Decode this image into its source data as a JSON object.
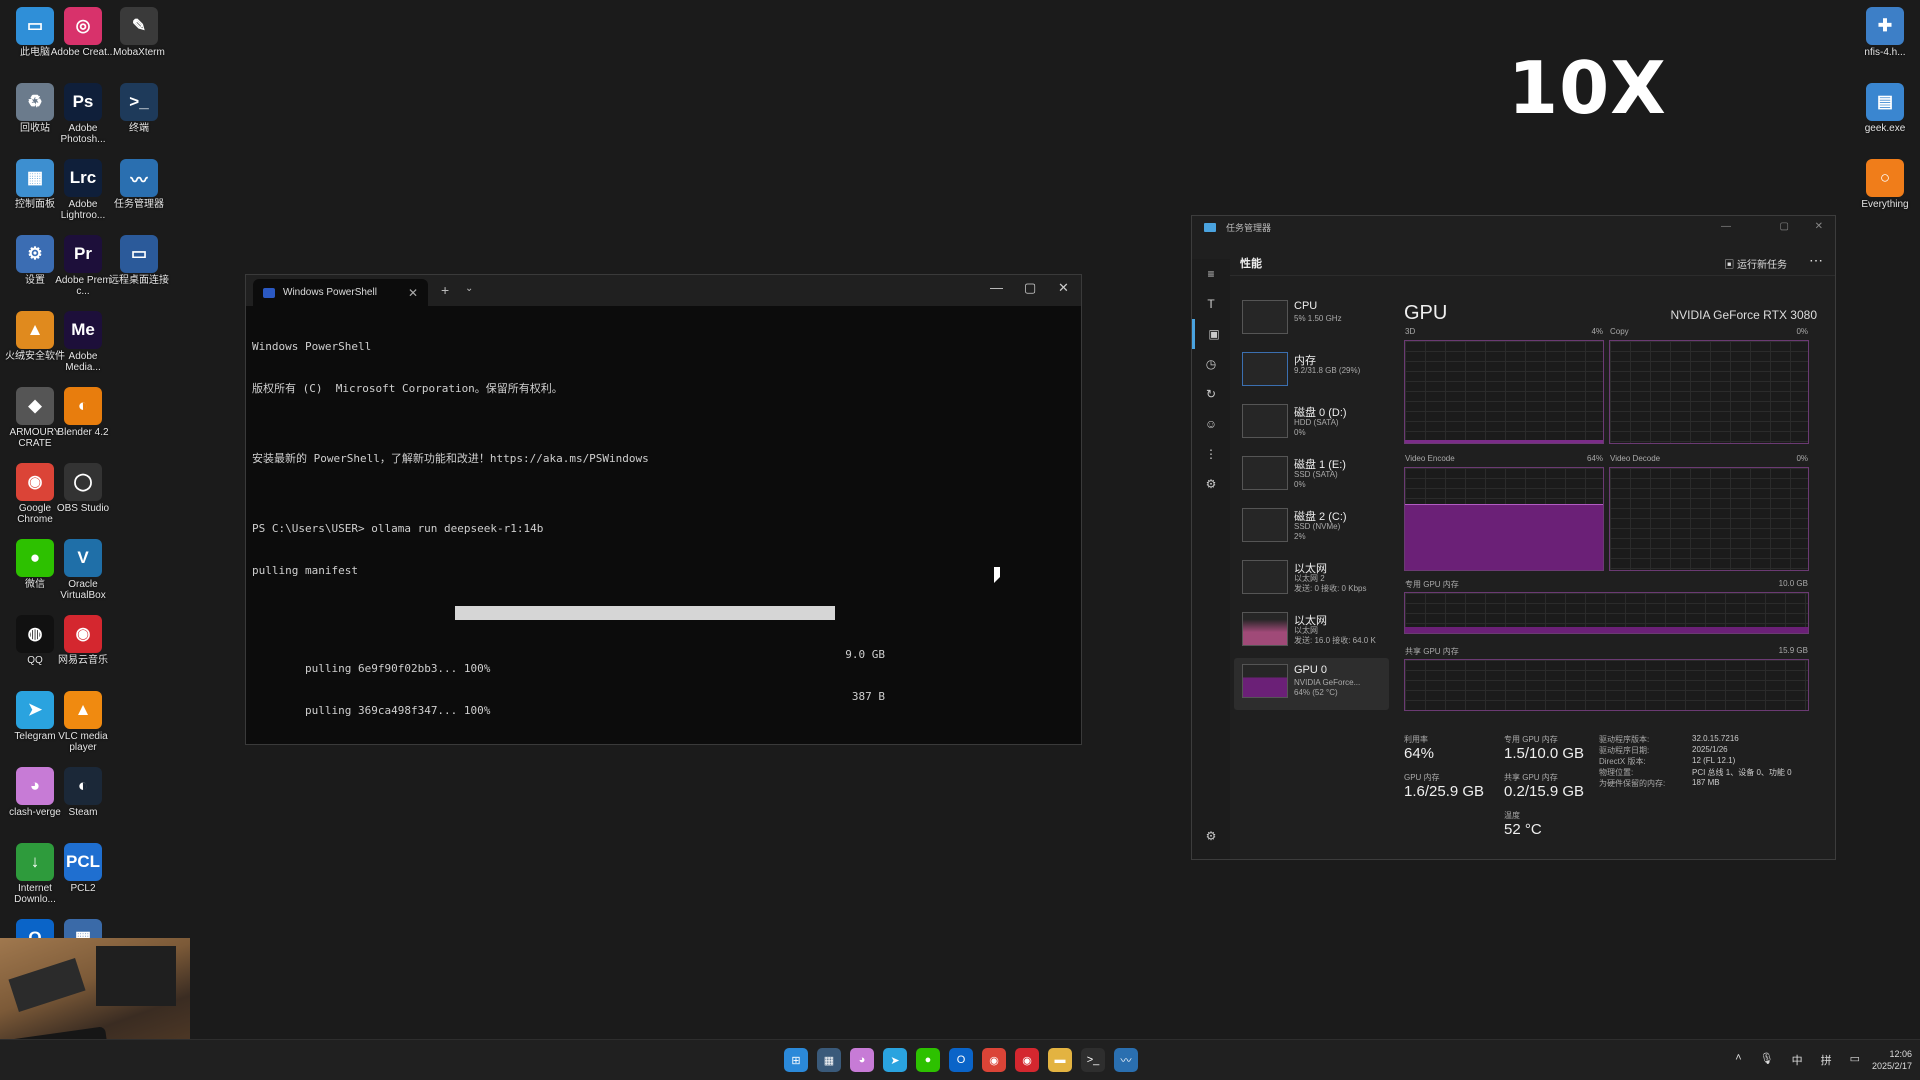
{
  "overlay": {
    "text": "10X"
  },
  "desktop": {
    "col1": [
      {
        "label": "此电脑",
        "icon": "computer-icon",
        "color": "#2f8fd8",
        "glyph": "▭"
      },
      {
        "label": "回收站",
        "icon": "recycle-bin-icon",
        "color": "#6b7b8c",
        "glyph": "♻"
      },
      {
        "label": "控制面板",
        "icon": "control-panel-icon",
        "color": "#3d8fd0",
        "glyph": "▦"
      },
      {
        "label": "设置",
        "icon": "settings-icon",
        "color": "#3b6db3",
        "glyph": "⚙"
      },
      {
        "label": "火绒安全软件",
        "icon": "huorong-icon",
        "color": "#e08a1e",
        "glyph": "▲"
      },
      {
        "label": "ARMOURY CRATE",
        "icon": "armoury-crate-icon",
        "color": "#555555",
        "glyph": "◆"
      },
      {
        "label": "Google Chrome",
        "icon": "chrome-icon",
        "color": "#db4437",
        "glyph": "◉"
      },
      {
        "label": "微信",
        "icon": "wechat-icon",
        "color": "#2dc100",
        "glyph": "●"
      },
      {
        "label": "QQ",
        "icon": "qq-icon",
        "color": "#111111",
        "glyph": "◍"
      },
      {
        "label": "Telegram",
        "icon": "telegram-icon",
        "color": "#2aa3df",
        "glyph": "➤"
      },
      {
        "label": "clash-verge",
        "icon": "clash-verge-icon",
        "color": "#c77bd6",
        "glyph": "◕"
      },
      {
        "label": "Internet Downlo...",
        "icon": "idm-icon",
        "color": "#2e9b3c",
        "glyph": "↓"
      },
      {
        "label": "Outlook",
        "icon": "outlook-icon",
        "color": "#0a64c8",
        "glyph": "O"
      }
    ],
    "col2": [
      {
        "label": "Adobe Creat...",
        "icon": "adobe-cc-icon",
        "color": "#d8326b",
        "glyph": "◎"
      },
      {
        "label": "Adobe Photosh...",
        "icon": "photoshop-icon",
        "color": "#0f1f3a",
        "glyph": "Ps"
      },
      {
        "label": "Adobe Lightroo...",
        "icon": "lightroom-icon",
        "color": "#0f1f3a",
        "glyph": "Lrc"
      },
      {
        "label": "Adobe Prem c...",
        "icon": "premiere-icon",
        "color": "#1d0f3a",
        "glyph": "Pr"
      },
      {
        "label": "Adobe Media...",
        "icon": "media-encoder-icon",
        "color": "#1d0f3a",
        "glyph": "Me"
      },
      {
        "label": "Blender 4.2",
        "icon": "blender-icon",
        "color": "#e87d0d",
        "glyph": "◐"
      },
      {
        "label": "OBS Studio",
        "icon": "obs-icon",
        "color": "#333333",
        "glyph": "◯"
      },
      {
        "label": "Oracle VirtualBox",
        "icon": "virtualbox-icon",
        "color": "#1f6fa8",
        "glyph": "V"
      },
      {
        "label": "网易云音乐",
        "icon": "netease-music-icon",
        "color": "#d4272f",
        "glyph": "◉"
      },
      {
        "label": "VLC media player",
        "icon": "vlc-icon",
        "color": "#f08a10",
        "glyph": "▲"
      },
      {
        "label": "Steam",
        "icon": "steam-icon",
        "color": "#1b2838",
        "glyph": "◐"
      },
      {
        "label": "PCL2",
        "icon": "pcl2-icon",
        "color": "#1f6fd0",
        "glyph": "PCL"
      },
      {
        "label": "计算器",
        "icon": "calculator-icon",
        "color": "#3a6aa8",
        "glyph": "▦"
      }
    ],
    "col3": [
      {
        "label": "MobaXterm",
        "icon": "mobaxterm-icon",
        "color": "#3a3a3a",
        "glyph": "✎"
      },
      {
        "label": "终端",
        "icon": "terminal-icon",
        "color": "#1e3a5a",
        "glyph": ">_"
      },
      {
        "label": "任务管理器",
        "icon": "task-manager-icon",
        "color": "#2a6fb0",
        "glyph": "〰"
      },
      {
        "label": "远程桌面连接",
        "icon": "remote-desktop-icon",
        "color": "#2b5a9a",
        "glyph": "▭"
      }
    ],
    "right": [
      {
        "label": "nfis-4.h...",
        "icon": "usb-tool-icon",
        "color": "#3d7fc7",
        "glyph": "✚"
      },
      {
        "label": "geek.exe",
        "icon": "geek-uninstaller-icon",
        "color": "#3a86d0",
        "glyph": "▤"
      },
      {
        "label": "Everything",
        "icon": "everything-icon",
        "color": "#f07d1a",
        "glyph": "○"
      }
    ]
  },
  "terminal": {
    "tab_title": "Windows PowerShell",
    "lines": [
      "Windows PowerShell",
      "版权所有 (C)  Microsoft Corporation。保留所有权利。",
      "",
      "安装最新的 PowerShell，了解新功能和改进！https://aka.ms/PSWindows",
      "",
      "PS C:\\Users\\USER> ollama run deepseek-r1:14b",
      "pulling manifest"
    ],
    "pulls": [
      {
        "text": "pulling 6e9f90f02bb3... 100%",
        "size": "9.0 GB",
        "progress": 1.0
      },
      {
        "text": "pulling 369ca498f347... 100%",
        "size": "387 B",
        "progress": 1.0
      }
    ]
  },
  "taskmgr": {
    "title": "任务管理器",
    "section": "性能",
    "run_task": "运行新任务",
    "resources": [
      {
        "name": "CPU",
        "sub": "5% 1.50 GHz"
      },
      {
        "name": "内存",
        "sub": "9.2/31.8 GB (29%)"
      },
      {
        "name": "磁盘 0 (D:)",
        "sub": "HDD (SATA)\n0%"
      },
      {
        "name": "磁盘 1 (E:)",
        "sub": "SSD (SATA)\n0%"
      },
      {
        "name": "磁盘 2 (C:)",
        "sub": "SSD (NVMe)\n2%"
      },
      {
        "name": "以太网",
        "sub": "以太网 2\n发送: 0 接收: 0 Kbps"
      },
      {
        "name": "以太网",
        "sub": "以太网\n发送: 16.0 接收: 64.0 K"
      },
      {
        "name": "GPU 0",
        "sub": "NVIDIA GeForce...\n64% (52 °C)"
      }
    ],
    "gpu_title": "GPU",
    "gpu_model": "NVIDIA GeForce RTX 3080",
    "graphs": {
      "3d": {
        "label": "3D",
        "pct": "4%"
      },
      "copy": {
        "label": "Copy",
        "pct": "0%"
      },
      "encode": {
        "label": "Video Encode",
        "pct": "64%",
        "level": 0.64
      },
      "decode": {
        "label": "Video Decode",
        "pct": "0%"
      },
      "dedicated": {
        "label": "专用 GPU 内存",
        "max": "10.0 GB"
      },
      "shared": {
        "label": "共享 GPU 内存",
        "max": "15.9 GB"
      }
    },
    "stats": {
      "util_label": "利用率",
      "util": "64%",
      "ded_label": "专用 GPU 内存",
      "ded": "1.5/10.0 GB",
      "gpumem_label": "GPU 内存",
      "gpumem": "1.6/25.9 GB",
      "shared_label": "共享 GPU 内存",
      "shared": "0.2/15.9 GB",
      "temp_label": "温度",
      "temp": "52 °C"
    },
    "info": [
      {
        "k": "驱动程序版本:",
        "v": "32.0.15.7216"
      },
      {
        "k": "驱动程序日期:",
        "v": "2025/1/26"
      },
      {
        "k": "DirectX 版本:",
        "v": "12 (FL 12.1)"
      },
      {
        "k": "物理位置:",
        "v": "PCI 总线 1、设备 0、功能 0"
      },
      {
        "k": "为硬件保留的内存:",
        "v": "187 MB"
      }
    ]
  },
  "taskbar": {
    "icons": [
      {
        "name": "start-icon",
        "color": "#2b89d9",
        "glyph": "⊞"
      },
      {
        "name": "taskmgr-taskbar-icon",
        "color": "#3a5a7a",
        "glyph": "▦"
      },
      {
        "name": "clash-taskbar-icon",
        "color": "#c77bd6",
        "glyph": "◕"
      },
      {
        "name": "telegram-taskbar-icon",
        "color": "#2aa3df",
        "glyph": "➤"
      },
      {
        "name": "wechat-taskbar-icon",
        "color": "#2dc100",
        "glyph": "●"
      },
      {
        "name": "outlook-taskbar-icon",
        "color": "#0a64c8",
        "glyph": "O"
      },
      {
        "name": "chrome-taskbar-icon",
        "color": "#db4437",
        "glyph": "◉"
      },
      {
        "name": "netease-taskbar-icon",
        "color": "#d4272f",
        "glyph": "◉"
      },
      {
        "name": "explorer-taskbar-icon",
        "color": "#e3b341",
        "glyph": "▬"
      },
      {
        "name": "terminal-taskbar-icon",
        "color": "#2e2e2e",
        "glyph": ">_"
      },
      {
        "name": "taskmgr2-taskbar-icon",
        "color": "#2a6fb0",
        "glyph": "〰"
      }
    ],
    "tray_ime": "中",
    "tray_layout": "拼",
    "time": "12:06",
    "date": "2025/2/17"
  }
}
